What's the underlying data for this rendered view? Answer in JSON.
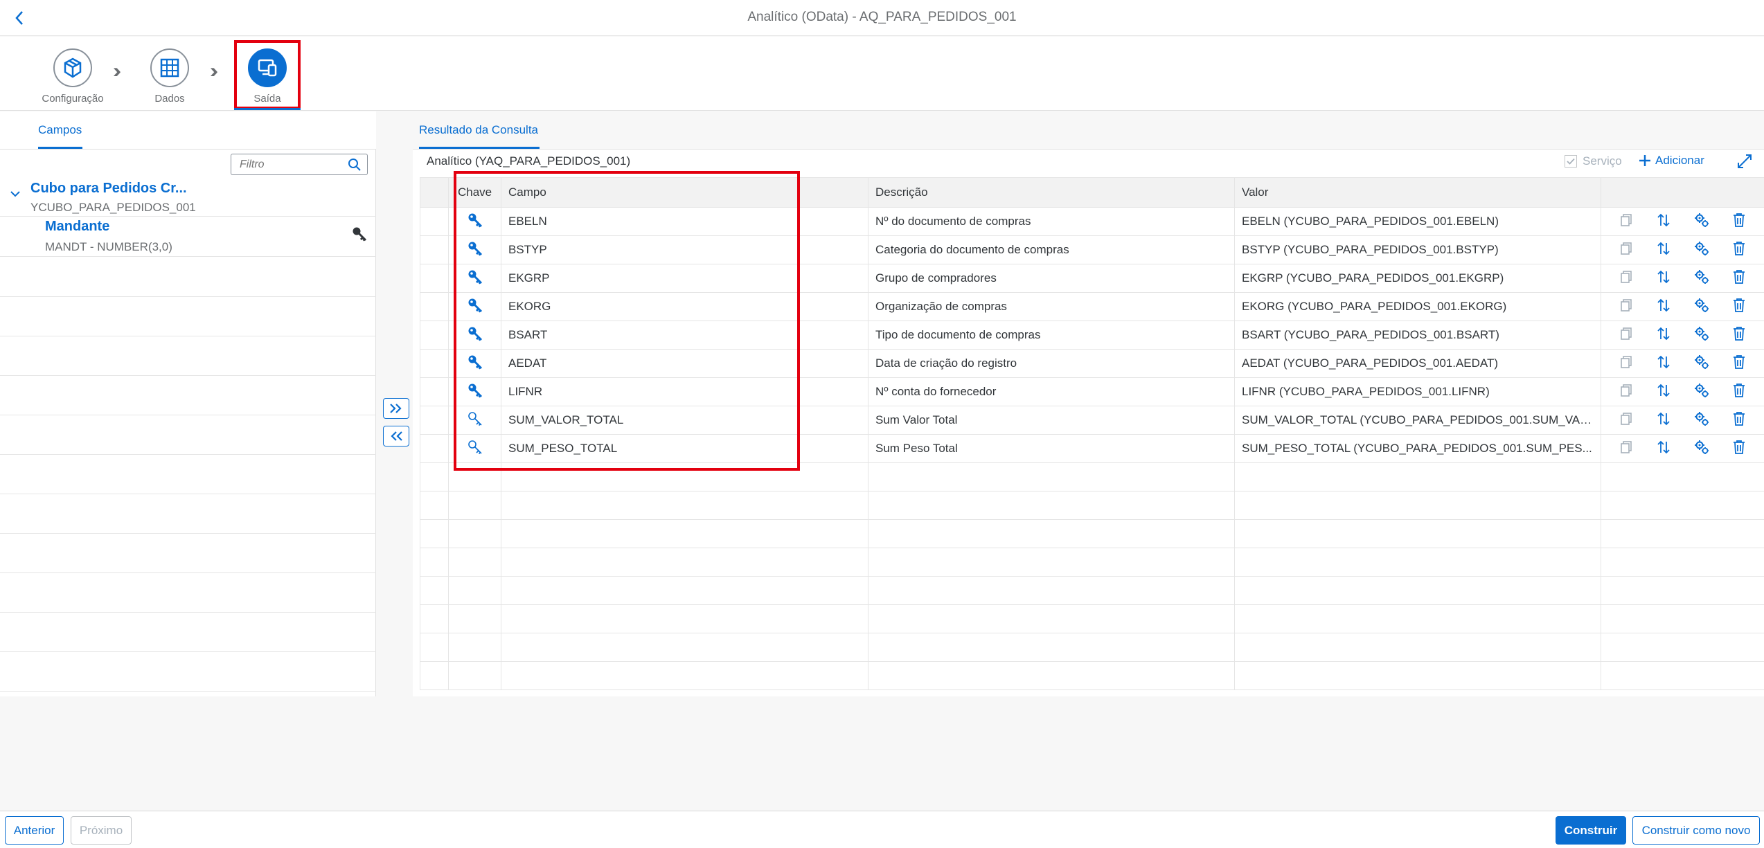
{
  "window": {
    "title": "Analítico (OData) - AQ_PARA_PEDIDOS_001"
  },
  "wizard": {
    "steps": [
      {
        "label": "Configuração",
        "icon": "cube-icon"
      },
      {
        "label": "Dados",
        "icon": "table-grid-icon"
      },
      {
        "label": "Saída",
        "icon": "output-devices-icon"
      }
    ]
  },
  "left": {
    "tab": "Campos",
    "filter_placeholder": "Filtro",
    "tree": {
      "node_title": "Cubo para Pedidos Cr...",
      "node_subtitle": "YCUBO_PARA_PEDIDOS_001",
      "item_title": "Mandante",
      "item_subtitle": "MANDT - NUMBER(3,0)"
    }
  },
  "right": {
    "tab": "Resultado da Consulta",
    "result_title": "Analítico (YAQ_PARA_PEDIDOS_001)",
    "servico_label": "Serviço",
    "adicionar_label": "Adicionar",
    "columns": {
      "chave": "Chave",
      "campo": "Campo",
      "descricao": "Descrição",
      "valor": "Valor"
    },
    "rows": [
      {
        "key": "filled",
        "campo": "EBELN",
        "descricao": "Nº do documento de compras",
        "valor": "EBELN (YCUBO_PARA_PEDIDOS_001.EBELN)"
      },
      {
        "key": "filled",
        "campo": "BSTYP",
        "descricao": "Categoria do documento de compras",
        "valor": "BSTYP (YCUBO_PARA_PEDIDOS_001.BSTYP)"
      },
      {
        "key": "filled",
        "campo": "EKGRP",
        "descricao": "Grupo de compradores",
        "valor": "EKGRP (YCUBO_PARA_PEDIDOS_001.EKGRP)"
      },
      {
        "key": "filled",
        "campo": "EKORG",
        "descricao": "Organização de compras",
        "valor": "EKORG (YCUBO_PARA_PEDIDOS_001.EKORG)"
      },
      {
        "key": "filled",
        "campo": "BSART",
        "descricao": "Tipo de documento de compras",
        "valor": "BSART (YCUBO_PARA_PEDIDOS_001.BSART)"
      },
      {
        "key": "filled",
        "campo": "AEDAT",
        "descricao": "Data de criação do registro",
        "valor": "AEDAT (YCUBO_PARA_PEDIDOS_001.AEDAT)"
      },
      {
        "key": "filled",
        "campo": "LIFNR",
        "descricao": "Nº conta do fornecedor",
        "valor": "LIFNR (YCUBO_PARA_PEDIDOS_001.LIFNR)"
      },
      {
        "key": "outline",
        "campo": "SUM_VALOR_TOTAL",
        "descricao": "Sum Valor Total",
        "valor": "SUM_VALOR_TOTAL (YCUBO_PARA_PEDIDOS_001.SUM_VAL..."
      },
      {
        "key": "outline",
        "campo": "SUM_PESO_TOTAL",
        "descricao": "Sum Peso Total",
        "valor": "SUM_PESO_TOTAL (YCUBO_PARA_PEDIDOS_001.SUM_PES..."
      }
    ],
    "empty_rows": 8
  },
  "footer": {
    "anterior": "Anterior",
    "proximo": "Próximo",
    "construir": "Construir",
    "construir_novo": "Construir como novo"
  },
  "colors": {
    "accent": "#0a6ed1",
    "highlight": "#e3000f"
  }
}
